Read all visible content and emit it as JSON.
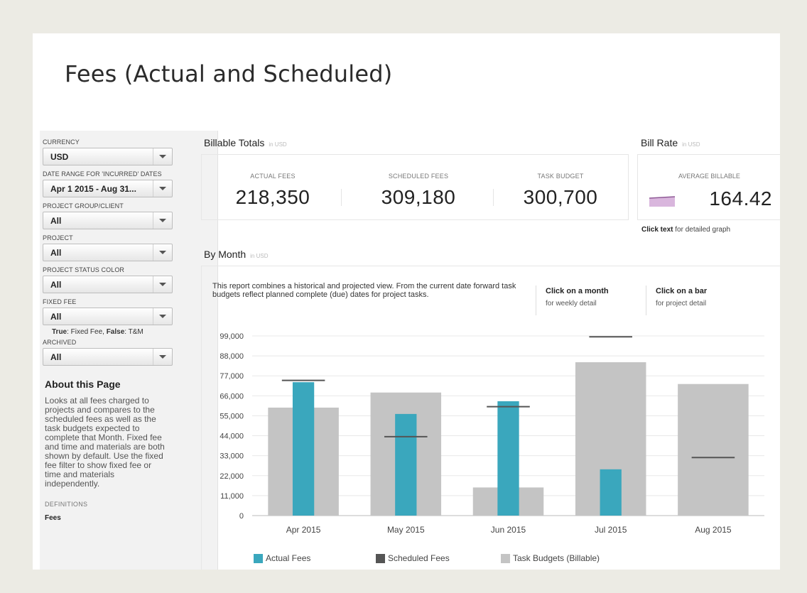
{
  "page": {
    "title": "Fees (Actual and Scheduled)"
  },
  "sidebar": {
    "filters": [
      {
        "label": "CURRENCY",
        "value": "USD"
      },
      {
        "label": "DATE RANGE FOR 'INCURRED' DATES",
        "value": "Apr 1 2015 - Aug 31..."
      },
      {
        "label": "PROJECT GROUP/CLIENT",
        "value": "All"
      },
      {
        "label": "PROJECT",
        "value": "All"
      },
      {
        "label": "PROJECT STATUS COLOR",
        "value": "All"
      },
      {
        "label": "FIXED FEE",
        "value": "All"
      },
      {
        "label": "ARCHIVED",
        "value": "All"
      }
    ],
    "fixed_fee_note": {
      "true_label": "True",
      "true_text": ": Fixed Fee, ",
      "false_label": "False",
      "false_text": ": T&M"
    },
    "about": {
      "title": "About this Page",
      "text": "Looks at all fees charged to projects and compares to the scheduled fees as well as the task budgets expected to complete that Month. Fixed fee and time and materials are both shown by default. Use the fixed fee filter to show fixed fee or time and materials independently."
    },
    "definitions": {
      "title": "DEFINITIONS",
      "first_item": "Fees"
    }
  },
  "billable_totals": {
    "title": "Billable Totals",
    "unit": "in USD",
    "metrics": [
      {
        "label": "ACTUAL FEES",
        "value": "218,350"
      },
      {
        "label": "SCHEDULED FEES",
        "value": "309,180"
      },
      {
        "label": "TASK BUDGET",
        "value": "300,700"
      }
    ]
  },
  "bill_rate": {
    "title": "Bill Rate",
    "unit": "in USD",
    "label": "AVERAGE BILLABLE",
    "value": "164.42",
    "note_bold": "Click text",
    "note_rest": " for detailed graph",
    "sparkline_color": "#d9b6dd"
  },
  "by_month": {
    "title": "By Month",
    "unit": "in USD",
    "description": "This report combines a historical and projected view.  From the current date forward task budgets reflect planned complete (due) dates for project tasks.",
    "hints": [
      {
        "bold": "Click on a month",
        "text": "for weekly detail"
      },
      {
        "bold": "Click on a bar",
        "text": "for project detail"
      }
    ]
  },
  "chart_data": {
    "type": "bar",
    "categories": [
      "Apr 2015",
      "May 2015",
      "Jun 2015",
      "Jul 2015",
      "Aug 2015"
    ],
    "series": [
      {
        "name": "Actual Fees",
        "color": "#3aa7bd",
        "values": [
          73500,
          56000,
          63000,
          25500,
          0
        ]
      },
      {
        "name": "Scheduled Fees",
        "color": "#555555",
        "values": [
          74500,
          43500,
          60000,
          98500,
          32000
        ]
      },
      {
        "name": "Task Budgets (Billable)",
        "color": "#c4c4c4",
        "values": [
          59500,
          67800,
          15500,
          84500,
          72500
        ]
      }
    ],
    "yticks": [
      "99,000",
      "88,000",
      "77,000",
      "66,000",
      "55,000",
      "44,000",
      "33,000",
      "22,000",
      "11,000",
      "0"
    ],
    "ylim": [
      0,
      99000
    ],
    "grid": true,
    "legend": "bottom"
  }
}
